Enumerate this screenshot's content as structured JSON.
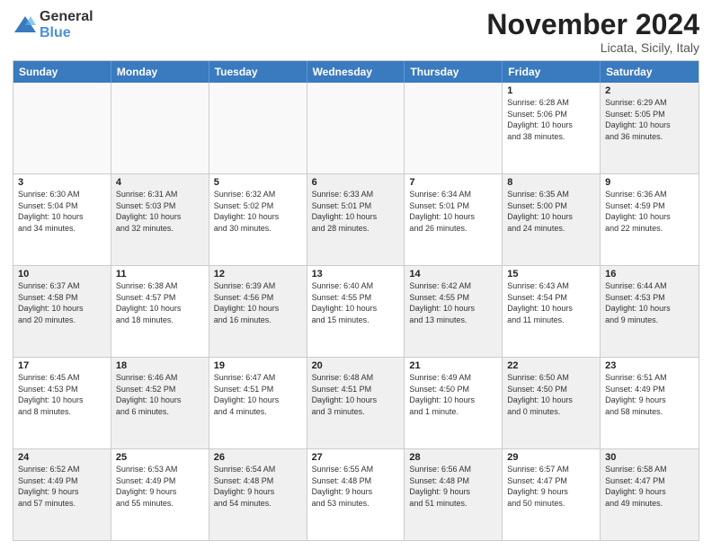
{
  "header": {
    "logo": {
      "general": "General",
      "blue": "Blue"
    },
    "title": "November 2024",
    "location": "Licata, Sicily, Italy"
  },
  "calendar": {
    "days_of_week": [
      "Sunday",
      "Monday",
      "Tuesday",
      "Wednesday",
      "Thursday",
      "Friday",
      "Saturday"
    ],
    "rows": [
      [
        {
          "day": "",
          "info": "",
          "empty": true
        },
        {
          "day": "",
          "info": "",
          "empty": true
        },
        {
          "day": "",
          "info": "",
          "empty": true
        },
        {
          "day": "",
          "info": "",
          "empty": true
        },
        {
          "day": "",
          "info": "",
          "empty": true
        },
        {
          "day": "1",
          "info": "Sunrise: 6:28 AM\nSunset: 5:06 PM\nDaylight: 10 hours\nand 38 minutes.",
          "empty": false
        },
        {
          "day": "2",
          "info": "Sunrise: 6:29 AM\nSunset: 5:05 PM\nDaylight: 10 hours\nand 36 minutes.",
          "empty": false,
          "shaded": true
        }
      ],
      [
        {
          "day": "3",
          "info": "Sunrise: 6:30 AM\nSunset: 5:04 PM\nDaylight: 10 hours\nand 34 minutes.",
          "empty": false
        },
        {
          "day": "4",
          "info": "Sunrise: 6:31 AM\nSunset: 5:03 PM\nDaylight: 10 hours\nand 32 minutes.",
          "empty": false,
          "shaded": true
        },
        {
          "day": "5",
          "info": "Sunrise: 6:32 AM\nSunset: 5:02 PM\nDaylight: 10 hours\nand 30 minutes.",
          "empty": false
        },
        {
          "day": "6",
          "info": "Sunrise: 6:33 AM\nSunset: 5:01 PM\nDaylight: 10 hours\nand 28 minutes.",
          "empty": false,
          "shaded": true
        },
        {
          "day": "7",
          "info": "Sunrise: 6:34 AM\nSunset: 5:01 PM\nDaylight: 10 hours\nand 26 minutes.",
          "empty": false
        },
        {
          "day": "8",
          "info": "Sunrise: 6:35 AM\nSunset: 5:00 PM\nDaylight: 10 hours\nand 24 minutes.",
          "empty": false,
          "shaded": true
        },
        {
          "day": "9",
          "info": "Sunrise: 6:36 AM\nSunset: 4:59 PM\nDaylight: 10 hours\nand 22 minutes.",
          "empty": false
        }
      ],
      [
        {
          "day": "10",
          "info": "Sunrise: 6:37 AM\nSunset: 4:58 PM\nDaylight: 10 hours\nand 20 minutes.",
          "empty": false,
          "shaded": true
        },
        {
          "day": "11",
          "info": "Sunrise: 6:38 AM\nSunset: 4:57 PM\nDaylight: 10 hours\nand 18 minutes.",
          "empty": false
        },
        {
          "day": "12",
          "info": "Sunrise: 6:39 AM\nSunset: 4:56 PM\nDaylight: 10 hours\nand 16 minutes.",
          "empty": false,
          "shaded": true
        },
        {
          "day": "13",
          "info": "Sunrise: 6:40 AM\nSunset: 4:55 PM\nDaylight: 10 hours\nand 15 minutes.",
          "empty": false
        },
        {
          "day": "14",
          "info": "Sunrise: 6:42 AM\nSunset: 4:55 PM\nDaylight: 10 hours\nand 13 minutes.",
          "empty": false,
          "shaded": true
        },
        {
          "day": "15",
          "info": "Sunrise: 6:43 AM\nSunset: 4:54 PM\nDaylight: 10 hours\nand 11 minutes.",
          "empty": false
        },
        {
          "day": "16",
          "info": "Sunrise: 6:44 AM\nSunset: 4:53 PM\nDaylight: 10 hours\nand 9 minutes.",
          "empty": false,
          "shaded": true
        }
      ],
      [
        {
          "day": "17",
          "info": "Sunrise: 6:45 AM\nSunset: 4:53 PM\nDaylight: 10 hours\nand 8 minutes.",
          "empty": false
        },
        {
          "day": "18",
          "info": "Sunrise: 6:46 AM\nSunset: 4:52 PM\nDaylight: 10 hours\nand 6 minutes.",
          "empty": false,
          "shaded": true
        },
        {
          "day": "19",
          "info": "Sunrise: 6:47 AM\nSunset: 4:51 PM\nDaylight: 10 hours\nand 4 minutes.",
          "empty": false
        },
        {
          "day": "20",
          "info": "Sunrise: 6:48 AM\nSunset: 4:51 PM\nDaylight: 10 hours\nand 3 minutes.",
          "empty": false,
          "shaded": true
        },
        {
          "day": "21",
          "info": "Sunrise: 6:49 AM\nSunset: 4:50 PM\nDaylight: 10 hours\nand 1 minute.",
          "empty": false
        },
        {
          "day": "22",
          "info": "Sunrise: 6:50 AM\nSunset: 4:50 PM\nDaylight: 10 hours\nand 0 minutes.",
          "empty": false,
          "shaded": true
        },
        {
          "day": "23",
          "info": "Sunrise: 6:51 AM\nSunset: 4:49 PM\nDaylight: 9 hours\nand 58 minutes.",
          "empty": false
        }
      ],
      [
        {
          "day": "24",
          "info": "Sunrise: 6:52 AM\nSunset: 4:49 PM\nDaylight: 9 hours\nand 57 minutes.",
          "empty": false,
          "shaded": true
        },
        {
          "day": "25",
          "info": "Sunrise: 6:53 AM\nSunset: 4:49 PM\nDaylight: 9 hours\nand 55 minutes.",
          "empty": false
        },
        {
          "day": "26",
          "info": "Sunrise: 6:54 AM\nSunset: 4:48 PM\nDaylight: 9 hours\nand 54 minutes.",
          "empty": false,
          "shaded": true
        },
        {
          "day": "27",
          "info": "Sunrise: 6:55 AM\nSunset: 4:48 PM\nDaylight: 9 hours\nand 53 minutes.",
          "empty": false
        },
        {
          "day": "28",
          "info": "Sunrise: 6:56 AM\nSunset: 4:48 PM\nDaylight: 9 hours\nand 51 minutes.",
          "empty": false,
          "shaded": true
        },
        {
          "day": "29",
          "info": "Sunrise: 6:57 AM\nSunset: 4:47 PM\nDaylight: 9 hours\nand 50 minutes.",
          "empty": false
        },
        {
          "day": "30",
          "info": "Sunrise: 6:58 AM\nSunset: 4:47 PM\nDaylight: 9 hours\nand 49 minutes.",
          "empty": false,
          "shaded": true
        }
      ]
    ]
  }
}
